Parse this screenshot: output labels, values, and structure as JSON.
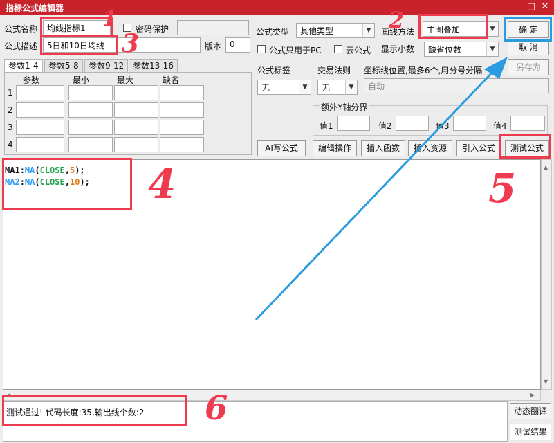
{
  "window": {
    "title": "指标公式编辑器",
    "restore_glyph": "□",
    "close_glyph": "✕"
  },
  "form": {
    "name_label": "公式名称",
    "name_value": "均线指标1",
    "password_label": "密码保护",
    "desc_label": "公式描述",
    "desc_value": "5日和10日均线",
    "version_label": "版本",
    "version_value": "0",
    "type_label": "公式类型",
    "type_value": "其他类型",
    "draw_label": "画线方法",
    "draw_value": "主图叠加",
    "pc_only_label": "公式只用于PC",
    "cloud_label": "云公式",
    "decimals_label": "显示小数",
    "decimals_value": "缺省位数",
    "tag_label": "公式标签",
    "tag_value": "无",
    "trade_label": "交易法则",
    "trade_value": "无",
    "coord_label": "坐标线位置,最多6个,用分号分隔",
    "coord_value": "自动",
    "yaxis_label": "额外Y轴分界",
    "yaxis_fields": [
      "值1",
      "值2",
      "值3",
      "值4"
    ]
  },
  "buttons": {
    "ok": "确  定",
    "cancel": "取  消",
    "save_as": "另存为",
    "ai_write": "AI写公式",
    "edit_ops": "编辑操作",
    "insert_func": "插入函数",
    "insert_res": "插入资源",
    "import": "引入公式",
    "test": "测试公式",
    "translate": "动态翻译",
    "test_result": "测试结果"
  },
  "param_tabs": [
    "参数1-4",
    "参数5-8",
    "参数9-12",
    "参数13-16"
  ],
  "param_headers": [
    "参数",
    "最小",
    "最大",
    "缺省"
  ],
  "param_rows": [
    "1",
    "2",
    "3",
    "4"
  ],
  "code": {
    "line1": {
      "name": "MA1",
      "colon": ":",
      "func": "MA",
      "open": "(",
      "arg": "CLOSE",
      "comma": ",",
      "num": "5",
      "close": ");"
    },
    "line2": {
      "name": "MA2",
      "colon": ":",
      "func": "MA",
      "open": "(",
      "arg": "CLOSE",
      "comma": ",",
      "num": "10",
      "close": ");"
    }
  },
  "status_text": "测试通过! 代码长度:35,输出线个数:2",
  "annotations": {
    "n1": "1",
    "n2": "2",
    "n3": "3",
    "n4": "4",
    "n5": "5",
    "n6": "6",
    "red": "#ef3b4e",
    "blue": "#2b9be0"
  }
}
